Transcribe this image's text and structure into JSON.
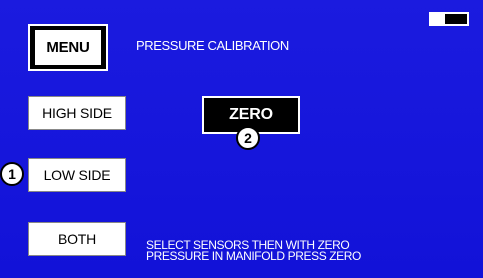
{
  "screen": {
    "title": "PRESSURE CALIBRATION",
    "instructions_line1": "SELECT SENSORS THEN WITH ZERO",
    "instructions_line2": "PRESSURE IN MANIFOLD PRESS ZERO"
  },
  "buttons": {
    "menu": "MENU",
    "high_side": "HIGH SIDE",
    "low_side": "LOW SIDE",
    "both": "BOTH",
    "zero": "ZERO"
  },
  "callouts": {
    "one": "1",
    "two": "2"
  },
  "colors": {
    "screen_background": "#1a1adb",
    "text": "#ffffff",
    "button_background": "#ffffff",
    "selected_button_background": "#000000"
  }
}
